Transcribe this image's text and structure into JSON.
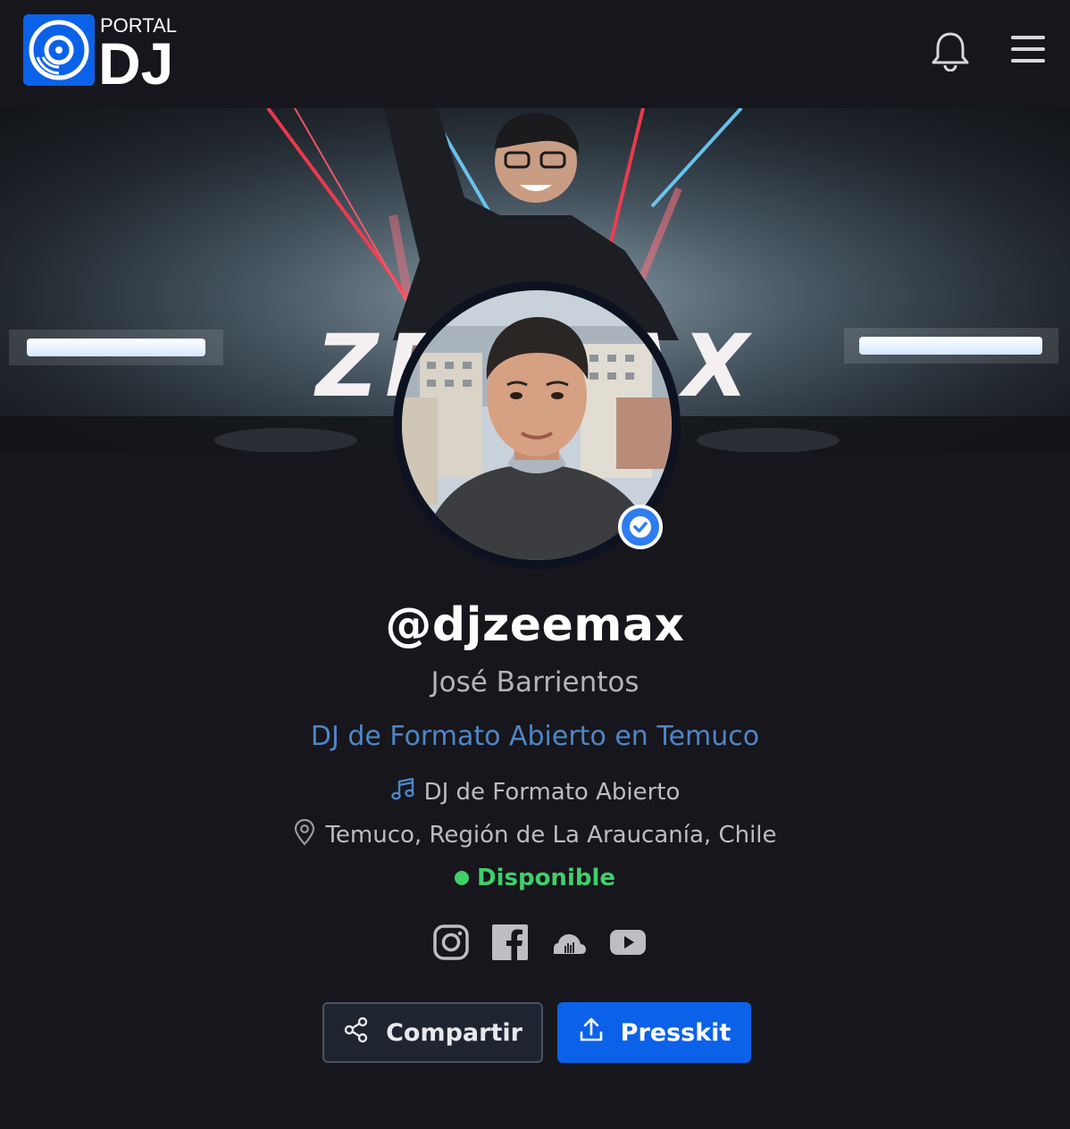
{
  "header": {
    "logo_top": "PORTAL",
    "logo_main": "DJ",
    "icons": [
      "logo-disc-icon",
      "bell-icon",
      "hamburger-menu-icon"
    ]
  },
  "banner": {
    "text": "ZEEMAX"
  },
  "profile": {
    "handle": "@djzeemax",
    "real_name": "José Barrientos",
    "tagline": "DJ de Formato Abierto en Temuco",
    "genre": "DJ de Formato Abierto",
    "location": "Temuco, Región de La Araucanía, Chile",
    "status": "Disponible",
    "verified": true
  },
  "socials": [
    "instagram-icon",
    "facebook-icon",
    "soundcloud-icon",
    "youtube-icon"
  ],
  "actions": {
    "share_label": "Compartir",
    "presskit_label": "Presskit"
  },
  "colors": {
    "background": "#17161c",
    "accent_blue": "#0b62e8",
    "tagline_blue": "#4f86c6",
    "status_green": "#3fd06a",
    "verified_blue": "#2f7cf2"
  }
}
